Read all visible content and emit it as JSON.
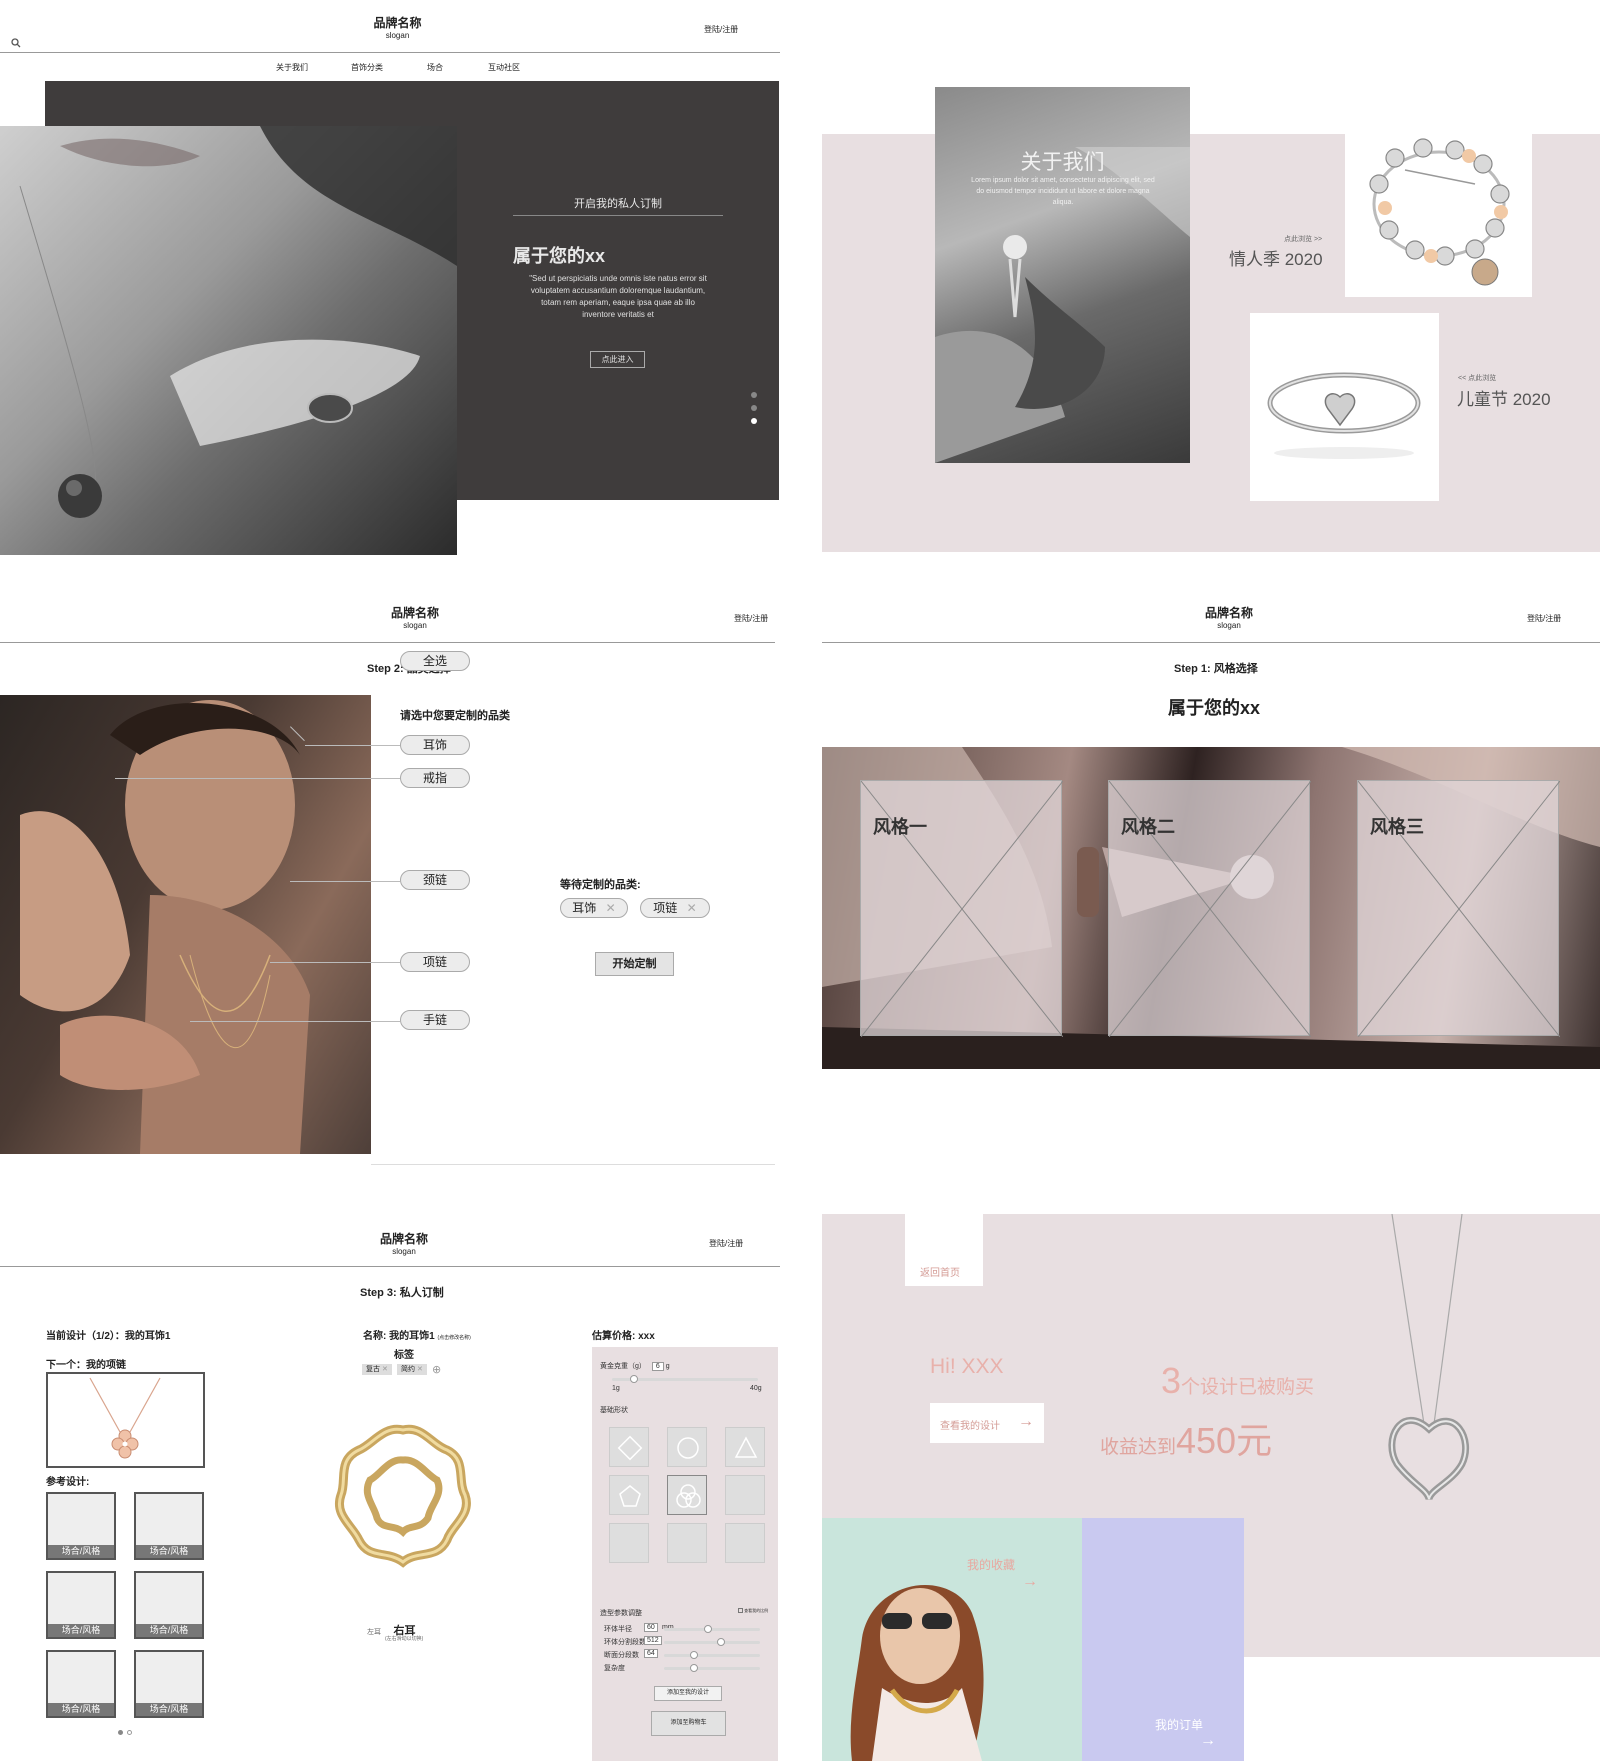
{
  "p1": {
    "brand": "品牌名称",
    "slogan": "slogan",
    "login": "登陆/注册",
    "nav": [
      "关于我们",
      "首饰分类",
      "场合",
      "互动社区"
    ],
    "hero_sub": "开启我的私人订制",
    "hero_title": "属于您的xx",
    "hero_quote": "\"Sed ut perspiciatis unde omnis iste natus error sit voluptatem accusantium doloremque laudantium, totam rem aperiam, eaque ipsa quae ab illo inventore veritatis et",
    "enter_btn": "点此进入",
    "carousel_active": 3,
    "carousel_total": 3
  },
  "p2": {
    "about_title": "关于我们",
    "about_text": "Lorem ipsum dolor sit amet, consectetur adipiscing elit, sed do eiusmod tempor incididunt ut labore et dolore magna aliqua.",
    "valentine_link": "点此浏览 >>",
    "valentine_title": "情人季 2020",
    "children_link": "<< 点此浏览",
    "children_title": "儿童节 2020"
  },
  "p3": {
    "brand": "品牌名称",
    "slogan": "slogan",
    "login": "登陆/注册",
    "step": "Step 2: 品类选择",
    "prompt": "请选中您要定制的品类",
    "select_all": "全选",
    "categories": [
      "耳饰",
      "戒指",
      "颈链",
      "项链",
      "手链"
    ],
    "pending_label": "等待定制的品类:",
    "pending": [
      "耳饰",
      "项链"
    ],
    "start_btn": "开始定制"
  },
  "p4": {
    "brand": "品牌名称",
    "slogan": "slogan",
    "login": "登陆/注册",
    "step": "Step 1: 风格选择",
    "title": "属于您的xx",
    "styles": [
      "风格一",
      "风格二",
      "风格三"
    ]
  },
  "p5": {
    "brand": "品牌名称",
    "slogan": "slogan",
    "login": "登陆/注册",
    "step": "Step 3: 私人订制",
    "current": "当前设计（1/2）：我的耳饰1",
    "next": "下一个：我的项链",
    "ref_label": "参考设计:",
    "ref_caption": "场合/风格",
    "name_label": "名称: 我的耳饰1",
    "name_hint": "(点击修改名称)",
    "tags_label": "标签",
    "tags": [
      "复古",
      "简约"
    ],
    "ear_left": "左耳",
    "ear_right": "右耳",
    "ear_hint": "(左右滑动以切换)",
    "price_label": "估算价格: xxx",
    "gold_label": "黄金克重（g）",
    "gold_value": "6",
    "gold_unit": "g",
    "gold_min": "1g",
    "gold_max": "40g",
    "gold_level": 0.13,
    "shape_label": "基础形状",
    "param_label": "造型参数调整",
    "param_check": "查看我的比例",
    "params": [
      {
        "label": "环体半径",
        "value": "60",
        "unit": "mm",
        "level": 0.45
      },
      {
        "label": "环体分割段数",
        "value": "512",
        "unit": "",
        "level": 0.6
      },
      {
        "label": "断面分段数",
        "value": "64",
        "unit": "",
        "level": 0.3
      },
      {
        "label": "复杂度",
        "value": "",
        "unit": "",
        "level": 0.3
      }
    ],
    "add_design_btn": "添加至我的设计",
    "add_cart_btn": "添加至购物车",
    "dots_active": 1,
    "dots_total": 2
  },
  "p6": {
    "back_home": "返回首页",
    "greeting": "Hi! XXX",
    "view_designs": "查看我的设计",
    "sold_num": "3",
    "sold_text": "个设计已被购买",
    "earn_prefix": "收益达到",
    "earn_value": "450元",
    "favorites": "我的收藏",
    "orders": "我的订单"
  }
}
